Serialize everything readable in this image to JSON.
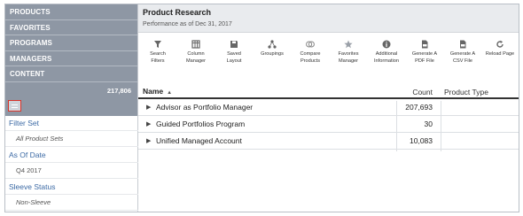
{
  "sidebar": {
    "nav": [
      "PRODUCTS",
      "FAVORITES",
      "PROGRAMS",
      "MANAGERS",
      "CONTENT"
    ],
    "content_count": "217,806",
    "filters": [
      {
        "label": "Filter Set",
        "value": "All Product Sets",
        "italic": true
      },
      {
        "label": "As Of Date",
        "value": "Q4 2017",
        "italic": false
      },
      {
        "label": "Sleeve Status",
        "value": "Non-Sleeve",
        "italic": true
      }
    ]
  },
  "header": {
    "title": "Product Research",
    "subtitle": "Performance as of Dec 31, 2017"
  },
  "toolbar": {
    "items": [
      {
        "icon": "search-filters-icon",
        "label": "Search\nFilters"
      },
      {
        "icon": "column-manager-icon",
        "label": "Column\nManager"
      },
      {
        "icon": "saved-layout-icon",
        "label": "Saved\nLayout"
      },
      {
        "icon": "groupings-icon",
        "label": "Groupings"
      },
      {
        "icon": "compare-products-icon",
        "label": "Compare\nProducts"
      },
      {
        "icon": "favorites-manager-icon",
        "label": "Favorites\nManager"
      },
      {
        "icon": "additional-information-icon",
        "label": "Additional\nInformation"
      },
      {
        "icon": "pdf-file-icon",
        "label": "Generate A\nPDF File"
      },
      {
        "icon": "csv-file-icon",
        "label": "Generate A\nCSV File"
      },
      {
        "icon": "reload-icon",
        "label": "Reload Page"
      }
    ]
  },
  "table": {
    "headers": {
      "name": "Name",
      "count": "Count",
      "type": "Product Type"
    },
    "rows": [
      {
        "name": "Advisor as Portfolio Manager",
        "count": "207,693",
        "type": ""
      },
      {
        "name": "Guided Portfolios Program",
        "count": "30",
        "type": ""
      },
      {
        "name": "Unified Managed Account",
        "count": "10,083",
        "type": ""
      }
    ]
  }
}
